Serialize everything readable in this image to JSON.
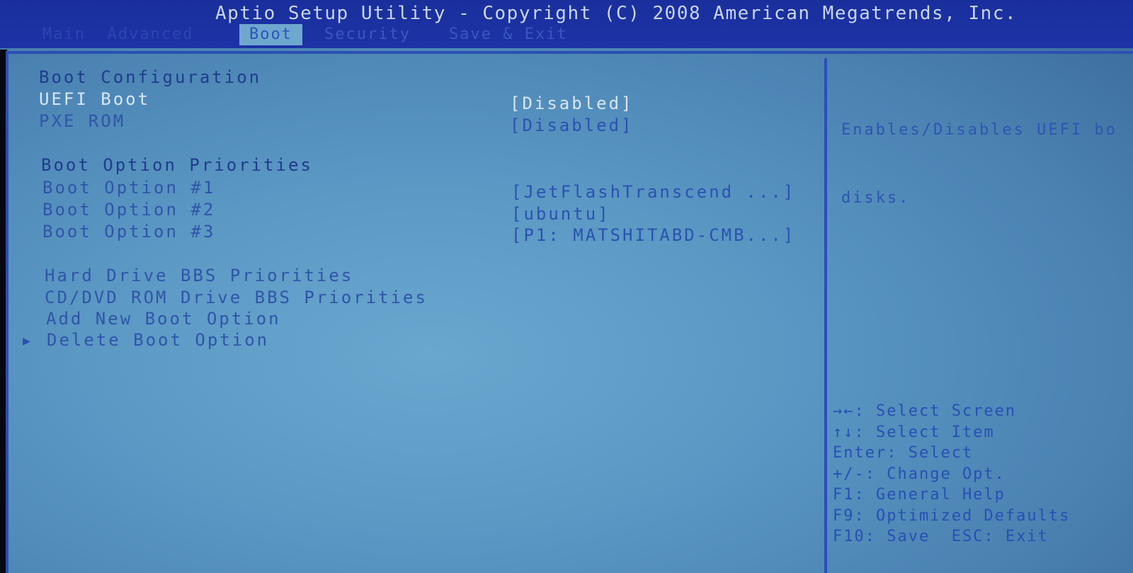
{
  "window": {
    "title": "Aptio Setup Utility - Copyright (C) 2008 American Megatrends, Inc."
  },
  "tabs": [
    {
      "label": "Main  Advanced",
      "active": false
    },
    {
      "label": "Boot",
      "active": true
    },
    {
      "label": "Security",
      "active": false
    },
    {
      "label": "Save & Exit",
      "active": false
    }
  ],
  "boot_config": {
    "heading": "Boot Configuration",
    "uefi_boot": {
      "label": "UEFI Boot",
      "value": "[Disabled]"
    },
    "pxe_rom": {
      "label": "PXE ROM",
      "value": "[Disabled]"
    }
  },
  "priorities": {
    "heading": "Boot Option Priorities",
    "options": [
      {
        "label": "Boot Option #1",
        "value": "[JetFlashTranscend ...]"
      },
      {
        "label": "Boot Option #2",
        "value": "[ubuntu]"
      },
      {
        "label": "Boot Option #3",
        "value": "[P1: MATSHITABD-CMB...]"
      }
    ]
  },
  "submenus": [
    {
      "label": "Hard Drive BBS Priorities"
    },
    {
      "label": "CD/DVD ROM Drive BBS Priorities"
    },
    {
      "label": "Add New Boot Option"
    },
    {
      "label": "Delete Boot Option"
    }
  ],
  "selected_marker": "▶",
  "help_text": {
    "line1": "Enables/Disables UEFI bo",
    "line2": "disks."
  },
  "key_legend": [
    "→←: Select Screen",
    "↑↓: Select Item",
    "Enter: Select",
    "+/-: Change Opt.",
    "F1: General Help",
    "F9: Optimized Defaults",
    "F10: Save  ESC: Exit"
  ],
  "colors": {
    "title_bar": "#1c33a6",
    "panel_bg": "#5b98c4",
    "divider": "#2b4fb5",
    "highlight_text": "#d8e6f6"
  }
}
